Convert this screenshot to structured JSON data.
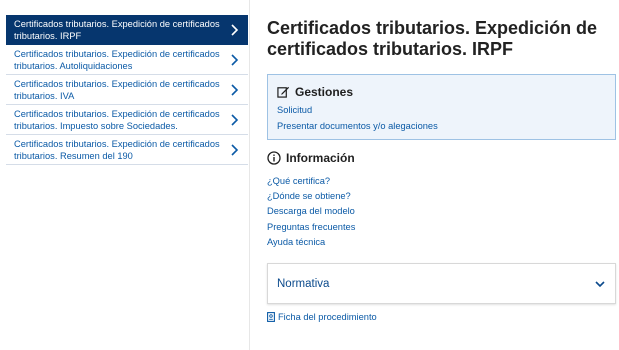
{
  "sidebar": {
    "items": [
      {
        "label": "Certificados tributarios. Expedición de certificados tributarios. IRPF",
        "active": true
      },
      {
        "label": "Certificados tributarios. Expedición de certificados tributarios. Autoliquidaciones",
        "active": false
      },
      {
        "label": "Certificados tributarios. Expedición de certificados tributarios. IVA",
        "active": false
      },
      {
        "label": "Certificados tributarios. Expedición de certificados tributarios. Impuesto sobre Sociedades.",
        "active": false
      },
      {
        "label": "Certificados tributarios. Expedición de certificados tributarios. Resumen del 190",
        "active": false
      }
    ]
  },
  "main": {
    "title": "Certificados tributarios. Expedición de certificados tributarios. IRPF",
    "gestiones": {
      "heading": "Gestiones",
      "links": [
        "Solicitud",
        "Presentar documentos y/o alegaciones"
      ]
    },
    "informacion": {
      "heading": "Información",
      "links": [
        "¿Qué certifica?",
        "¿Dónde se obtiene?",
        "Descarga del modelo",
        "Preguntas frecuentes",
        "Ayuda técnica"
      ]
    },
    "normativa": {
      "label": "Normativa"
    },
    "ficha": {
      "label": "Ficha del procedimiento"
    }
  },
  "colors": {
    "active_bg": "#06366e",
    "link": "#0b5aa6",
    "box_bg": "#eef4fb",
    "box_border": "#9ec2e4"
  }
}
